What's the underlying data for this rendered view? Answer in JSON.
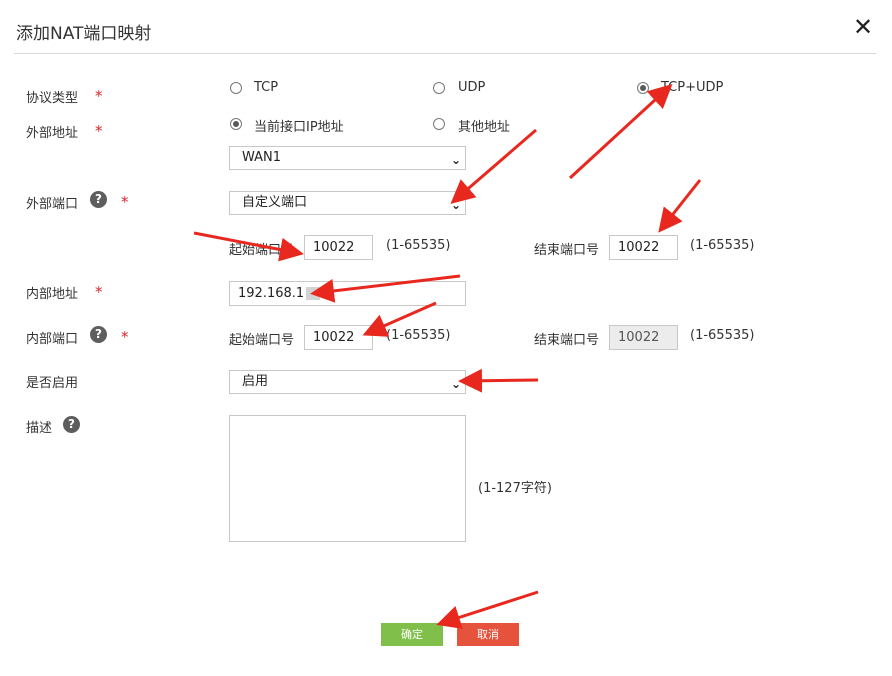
{
  "dialog": {
    "title": "添加NAT端口映射",
    "close_glyph": "✕"
  },
  "form": {
    "protocol": {
      "label": "协议类型",
      "required": "*",
      "options": [
        "TCP",
        "UDP",
        "TCP+UDP"
      ],
      "selected": "TCP+UDP"
    },
    "external_address": {
      "label": "外部地址",
      "required": "*",
      "options": [
        "当前接口IP地址",
        "其他地址"
      ],
      "selected": "当前接口IP地址",
      "interface_value": "WAN1"
    },
    "external_port": {
      "label": "外部端口",
      "help": "?",
      "required": "*",
      "mode_value": "自定义端口",
      "start_label": "起始端口号",
      "start_value": "10022",
      "start_range": "(1-65535)",
      "end_label": "结束端口号",
      "end_value": "10022",
      "end_range": "(1-65535)"
    },
    "internal_address": {
      "label": "内部地址",
      "required": "*",
      "value": "192.168.1"
    },
    "internal_port": {
      "label": "内部端口",
      "help": "?",
      "required": "*",
      "start_label": "起始端口号",
      "start_value": "10022",
      "start_range": "(1-65535)",
      "end_label": "结束端口号",
      "end_value": "10022",
      "end_range": "(1-65535)"
    },
    "enabled": {
      "label": "是否启用",
      "value": "启用"
    },
    "description": {
      "label": "描述",
      "help": "?",
      "hint": "(1-127字符)"
    }
  },
  "buttons": {
    "ok": "确定",
    "cancel": "取消"
  },
  "icons": {
    "close": "close-icon",
    "help": "help-icon",
    "caret": "chevron-down-icon"
  },
  "colors": {
    "required": "#d9262c",
    "ok_button": "#7fbf4a",
    "cancel_button": "#e5533c",
    "annotation_arrow": "#e8281e"
  }
}
